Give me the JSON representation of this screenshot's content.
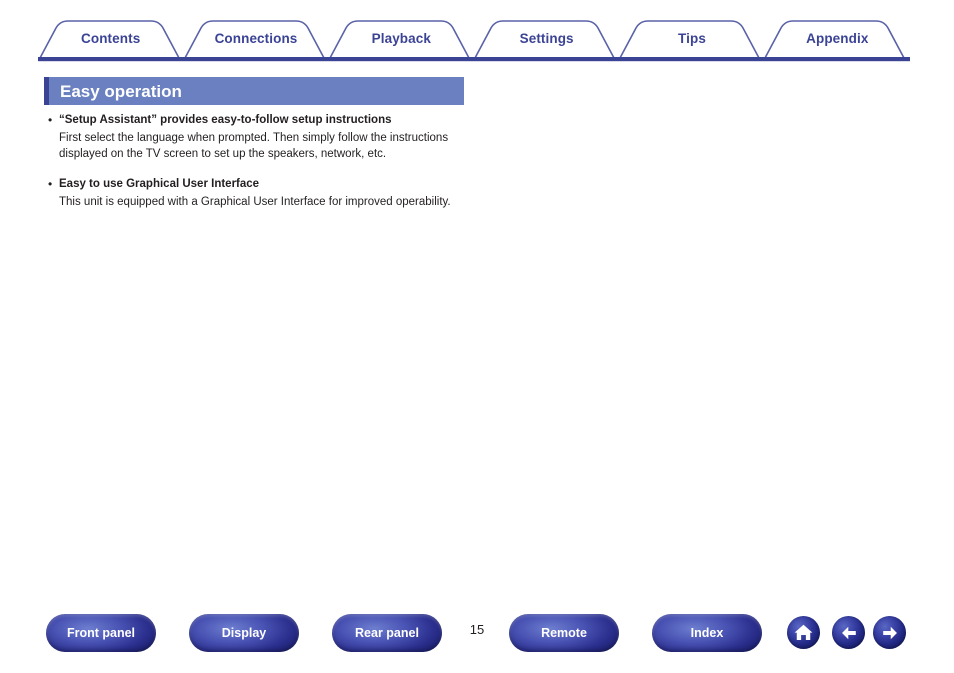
{
  "document": {
    "title": "Easy operation",
    "page_number": "15"
  },
  "tabs": [
    {
      "label": "Contents",
      "name": "tab-contents"
    },
    {
      "label": "Connections",
      "name": "tab-connections"
    },
    {
      "label": "Playback",
      "name": "tab-playback"
    },
    {
      "label": "Settings",
      "name": "tab-settings"
    },
    {
      "label": "Tips",
      "name": "tab-tips"
    },
    {
      "label": "Appendix",
      "name": "tab-appendix"
    }
  ],
  "content": {
    "items": [
      {
        "title": "“Setup Assistant” provides easy-to-follow setup instructions",
        "body": "First select the language when prompted. Then simply follow the instructions displayed on the TV screen to set up the speakers, network, etc."
      },
      {
        "title": "Easy to use Graphical User Interface",
        "body": "This unit is equipped with a Graphical User Interface for improved operability."
      }
    ],
    "bullet_glyph": "•"
  },
  "bottom_nav": {
    "buttons": [
      {
        "label": "Front panel",
        "name": "front-panel-button"
      },
      {
        "label": "Display",
        "name": "display-button"
      },
      {
        "label": "Rear panel",
        "name": "rear-panel-button"
      },
      {
        "label": "Remote",
        "name": "remote-button"
      },
      {
        "label": "Index",
        "name": "index-button"
      }
    ],
    "icons": [
      {
        "name": "home-icon",
        "label": "Home"
      },
      {
        "name": "arrow-left-icon",
        "label": "Previous page"
      },
      {
        "name": "arrow-right-icon",
        "label": "Next page"
      }
    ]
  },
  "colors": {
    "tab_text": "#3b4395",
    "tab_outline": "#5a62a8",
    "rule": "#3b4395",
    "heading_fill": "#6b80c0",
    "heading_accent": "#3b4395",
    "heading_text": "#ffffff",
    "body_text": "#231f20",
    "button_blue": "#2b2f8e",
    "page_background": "#ffffff"
  }
}
